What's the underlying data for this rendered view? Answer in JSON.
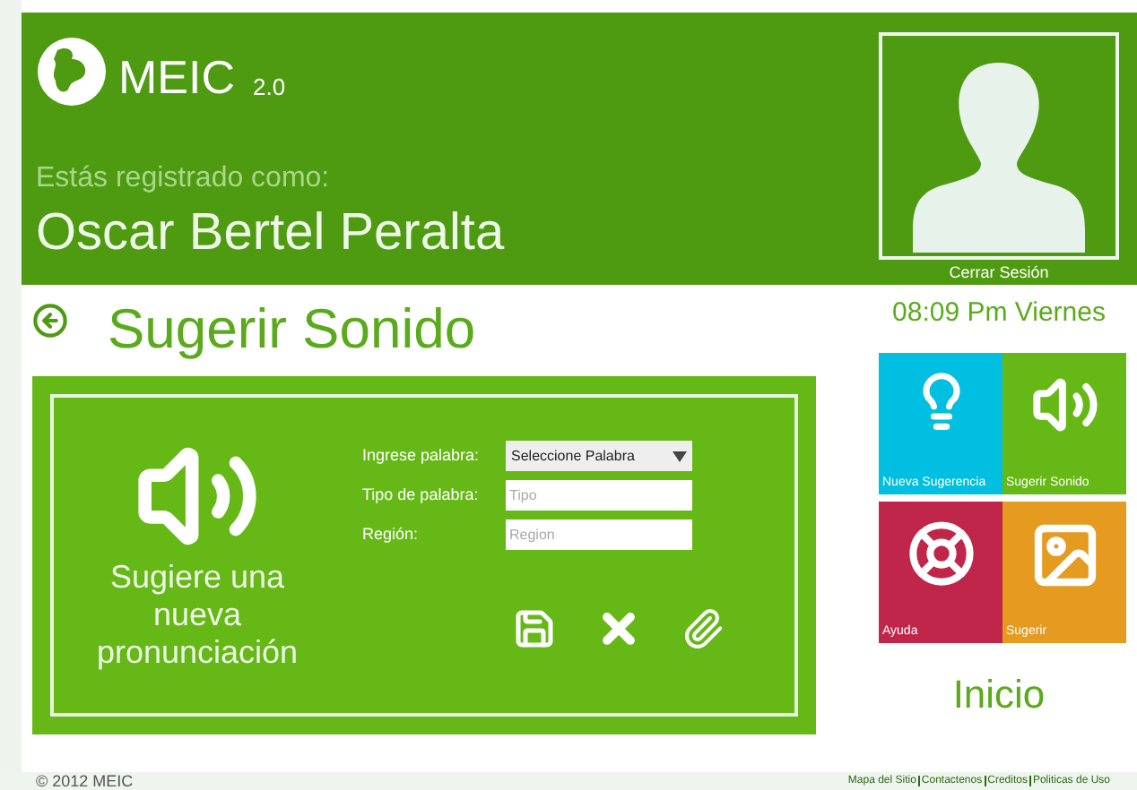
{
  "header": {
    "logo": "MEIC",
    "version": "2.0",
    "registered_label": "Estás registrado como:",
    "user_name": "Oscar Bertel Peralta",
    "logout": "Cerrar Sesión"
  },
  "clock": "08:09 Pm Viernes",
  "page_title": "Sugerir Sonido",
  "panel": {
    "caption": "Sugiere una nueva pronunciación",
    "fields": [
      {
        "kind": "select",
        "label": "Ingrese palabra:",
        "value": "Seleccione Palabra"
      },
      {
        "kind": "text",
        "label": "Tipo de palabra:",
        "placeholder": "Tipo"
      },
      {
        "kind": "text",
        "label": "Región:",
        "placeholder": "Region"
      }
    ],
    "actions": [
      {
        "kind": "save"
      },
      {
        "kind": "cancel"
      },
      {
        "kind": "attach"
      }
    ]
  },
  "tiles": [
    {
      "kind": "bulb",
      "label": "Nueva Sugerencia",
      "color": "#00bfe0"
    },
    {
      "kind": "sound",
      "label": "Sugerir Sonido",
      "color": "#65b816"
    },
    {
      "kind": "help",
      "label": "Ayuda",
      "color": "#c0254a"
    },
    {
      "kind": "image",
      "label": "Sugerir",
      "color": "#e59a20"
    }
  ],
  "home_label": "Inicio",
  "footer": {
    "copyright": "© 2012 MEIC",
    "links": [
      "Mapa del Sitio",
      "Contactenos",
      "Creditos",
      "Politicas de Uso"
    ]
  }
}
